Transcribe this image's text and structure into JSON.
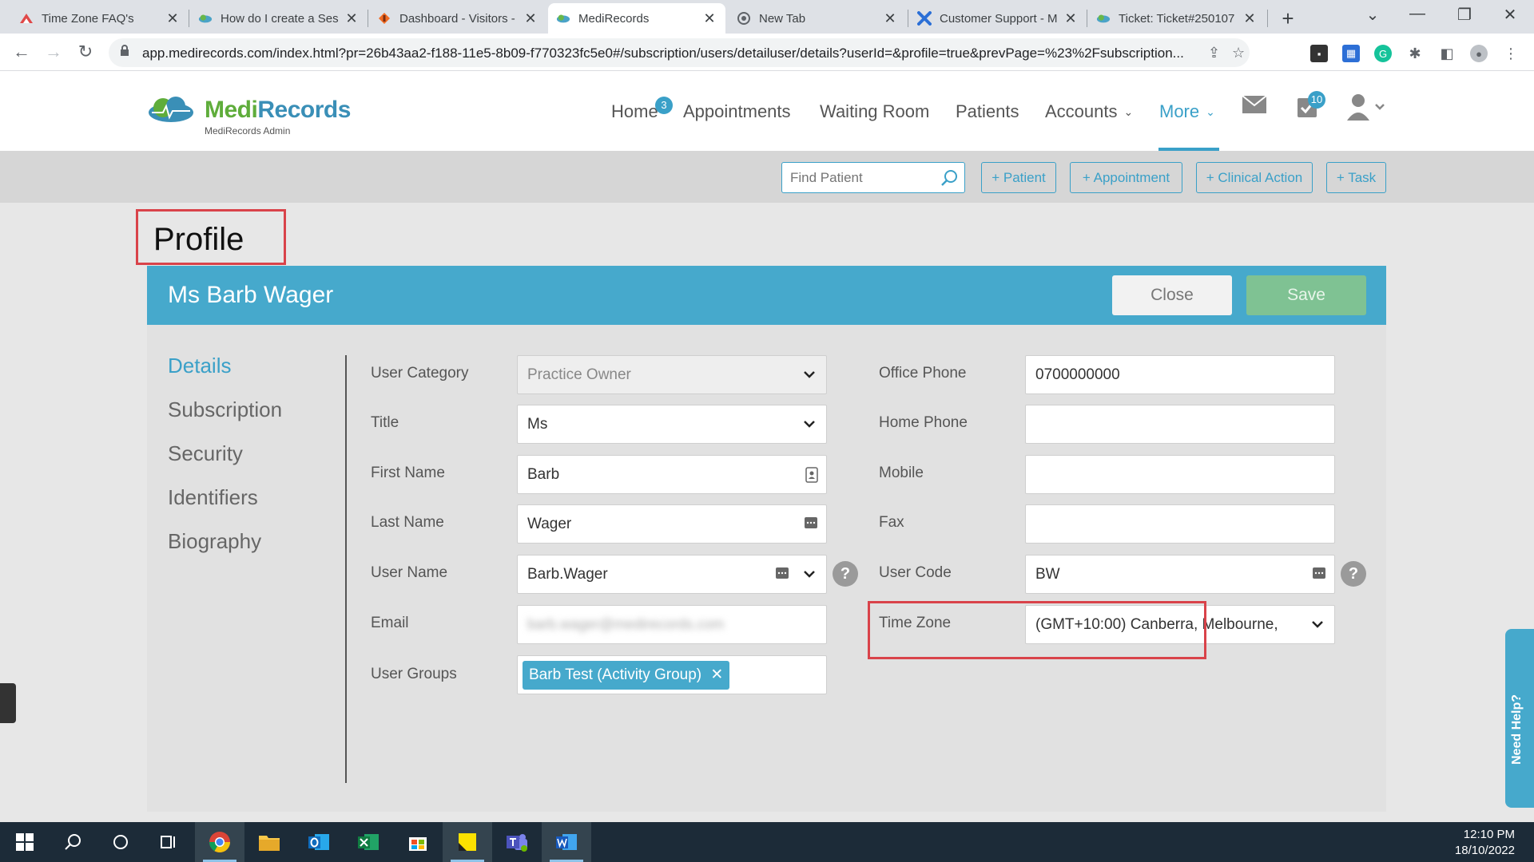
{
  "browser": {
    "tabs": [
      {
        "label": "Time Zone FAQ's",
        "icon": "zoho-icon"
      },
      {
        "label": "How do I create a Ses",
        "icon": "medirecords-icon"
      },
      {
        "label": "Dashboard - Visitors -",
        "icon": "dashboard-icon"
      },
      {
        "label": "MediRecords",
        "icon": "medirecords-icon"
      },
      {
        "label": "New Tab",
        "icon": "chrome-icon"
      },
      {
        "label": "Customer Support - M",
        "icon": "support-icon"
      },
      {
        "label": "Ticket: Ticket#250107",
        "icon": "medirecords-icon"
      }
    ],
    "url": "app.medirecords.com/index.html?pr=26b43aa2-f188-11e5-8b09-f770323fc5e0#/subscription/users/detailuser/details?userId=&profile=true&prevPage=%23%2Fsubscription..."
  },
  "app": {
    "logo_main_1": "Medi",
    "logo_main_2": "Records",
    "logo_sub": "MediRecords Admin",
    "nav": {
      "home": "Home",
      "home_badge": "3",
      "appointments": "Appointments",
      "waiting_room": "Waiting Room",
      "patients": "Patients",
      "accounts": "Accounts",
      "more": "More",
      "tasks_badge": "10"
    },
    "toolbar": {
      "find_placeholder": "Find Patient",
      "add_patient": "+ Patient",
      "add_appointment": "+ Appointment",
      "add_clinical_action": "+ Clinical Action",
      "add_task": "+ Task"
    }
  },
  "profile": {
    "title": "Profile",
    "name": "Ms Barb Wager",
    "close_label": "Close",
    "save_label": "Save",
    "sidenav": [
      "Details",
      "Subscription",
      "Security",
      "Identifiers",
      "Biography"
    ],
    "fields": {
      "user_category": {
        "label": "User Category",
        "value": "Practice Owner"
      },
      "title": {
        "label": "Title",
        "value": "Ms"
      },
      "first_name": {
        "label": "First Name",
        "value": "Barb"
      },
      "last_name": {
        "label": "Last Name",
        "value": "Wager"
      },
      "user_name": {
        "label": "User Name",
        "value": "Barb.Wager"
      },
      "email": {
        "label": "Email",
        "value": "barb.wager@medirecords.com"
      },
      "user_groups": {
        "label": "User Groups",
        "value": "Barb Test (Activity Group)"
      },
      "office_phone": {
        "label": "Office Phone",
        "value": "0700000000"
      },
      "home_phone": {
        "label": "Home Phone",
        "value": ""
      },
      "mobile": {
        "label": "Mobile",
        "value": ""
      },
      "fax": {
        "label": "Fax",
        "value": ""
      },
      "user_code": {
        "label": "User Code",
        "value": "BW"
      },
      "time_zone": {
        "label": "Time Zone",
        "value": "(GMT+10:00) Canberra, Melbourne,"
      }
    },
    "need_help": "Need Help?"
  },
  "taskbar": {
    "time": "12:10 PM",
    "date": "18/10/2022"
  },
  "colors": {
    "accent": "#46a9cc",
    "highlight_box": "#d9434a",
    "save_button": "#7fc293"
  }
}
